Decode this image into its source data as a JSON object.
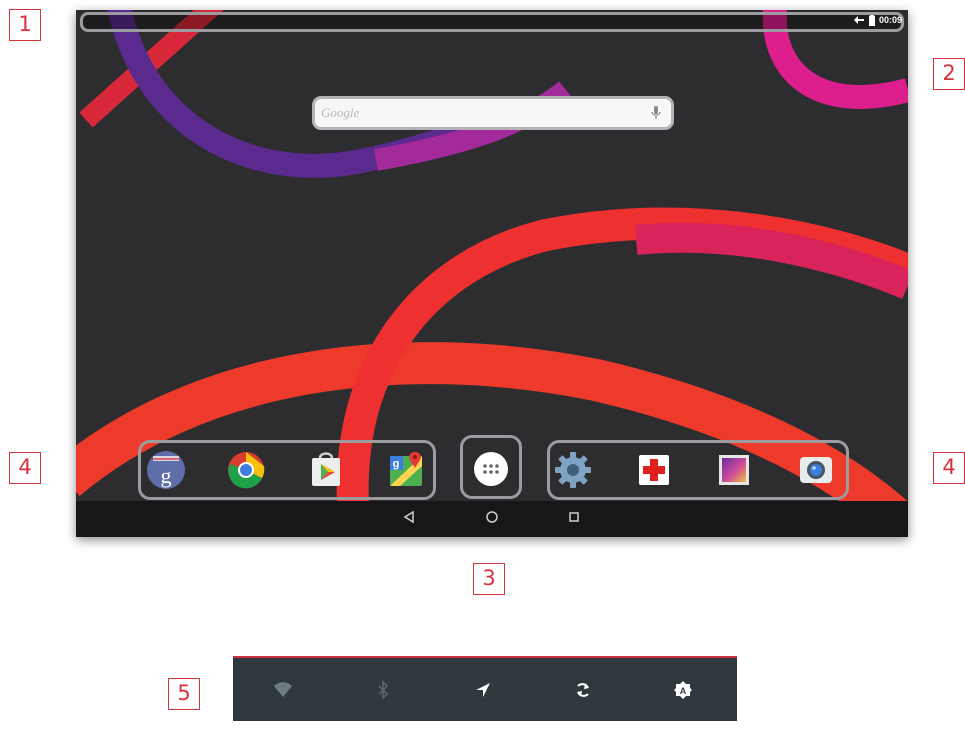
{
  "callouts": {
    "c1": "1",
    "c2": "2",
    "c3": "3",
    "c4_left": "4",
    "c4_right": "4",
    "c5": "5"
  },
  "status_bar": {
    "time": "00:09",
    "icons": [
      "data-sync-icon",
      "battery-icon"
    ]
  },
  "search": {
    "placeholder": "Google",
    "icon": "mic-icon"
  },
  "dock": {
    "left_group": [
      "google-search-app-icon",
      "chrome-app-icon",
      "play-store-app-icon",
      "maps-app-icon"
    ],
    "app_drawer": "app-drawer-icon",
    "right_group": [
      "settings-app-icon",
      "health-app-icon",
      "gallery-app-icon",
      "camera-app-icon"
    ]
  },
  "nav_bar": [
    "back-icon",
    "home-icon",
    "recents-icon"
  ],
  "quick_settings": [
    "wifi-icon",
    "bluetooth-icon",
    "location-icon",
    "auto-rotate-icon",
    "brightness-auto-icon"
  ],
  "colors": {
    "callout": "#d8323c",
    "highlight_border": "#9c9ca0",
    "wallpaper_bg": "#2d2d2f",
    "qs_panel": "#2f383d",
    "qs_accent": "#c9323d"
  }
}
